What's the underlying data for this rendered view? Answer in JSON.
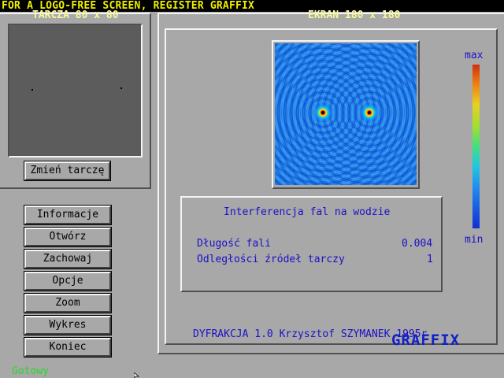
{
  "banner": {
    "text": "FOR A LOGO-FREE SCREEN, REGISTER GRAFFIX",
    "color": "#f0f000"
  },
  "target_panel": {
    "title": "TARCZA 80 x 80",
    "change_button": "Zmień tarczę"
  },
  "screen_panel": {
    "title": "EKRAN 180 x 180"
  },
  "colorbar": {
    "max_label": "max",
    "min_label": "min"
  },
  "info_box": {
    "heading": "Interferencja fal na wodzie",
    "rows": [
      {
        "label": "Długość fali",
        "value": "0.004"
      },
      {
        "label": "Odległości źródeł tarczy",
        "value": "1"
      }
    ]
  },
  "menu": [
    "Informacje",
    "Otwórz",
    "Zachowaj",
    "Opcje",
    "Zoom",
    "Wykres",
    "Koniec"
  ],
  "footer": {
    "credit": "DYFRAKCJA 1.0 Krzysztof SZYMANEK 1995r",
    "logo": "GRAFFIX"
  },
  "status": {
    "text": "Gotowy"
  },
  "colors": {
    "text_blue": "#1c10c8",
    "status_green": "#28d828",
    "pale_yellow": "#f8f8a0"
  }
}
